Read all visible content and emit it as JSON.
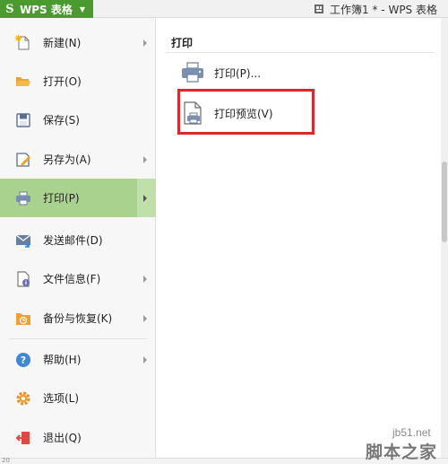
{
  "titlebar": {
    "app_name": "WPS 表格",
    "logo_glyph": "S",
    "document_title": "工作簿1 * - WPS 表格"
  },
  "menu": [
    {
      "label": "新建(N)",
      "icon": "new-file-icon",
      "has_submenu": true
    },
    {
      "label": "打开(O)",
      "icon": "open-folder-icon",
      "has_submenu": false
    },
    {
      "label": "保存(S)",
      "icon": "save-icon",
      "has_submenu": false
    },
    {
      "label": "另存为(A)",
      "icon": "save-as-icon",
      "has_submenu": true
    },
    {
      "label": "打印(P)",
      "icon": "printer-icon",
      "has_submenu": true,
      "active": true
    },
    {
      "label": "发送邮件(D)",
      "icon": "mail-icon",
      "has_submenu": false
    },
    {
      "label": "文件信息(F)",
      "icon": "file-info-icon",
      "has_submenu": true
    },
    {
      "label": "备份与恢复(K)",
      "icon": "backup-icon",
      "has_submenu": true
    },
    {
      "label": "帮助(H)",
      "icon": "help-icon",
      "has_submenu": true
    },
    {
      "label": "选项(L)",
      "icon": "gear-icon",
      "has_submenu": false
    },
    {
      "label": "退出(Q)",
      "icon": "exit-icon",
      "has_submenu": false
    }
  ],
  "submenu": {
    "title": "打印",
    "items": [
      {
        "label": "打印(P)...",
        "icon": "printer-icon"
      },
      {
        "label": "打印预览(V)",
        "icon": "print-preview-icon",
        "highlighted": true
      }
    ]
  },
  "colors": {
    "brand_green": "#4a9a2f",
    "active_item": "#a9d28f",
    "highlight_box": "#e0262b"
  },
  "bottom": {
    "cell_ref": "20"
  },
  "watermark": {
    "line1": "jb51.net",
    "line2": "脚本之家"
  }
}
